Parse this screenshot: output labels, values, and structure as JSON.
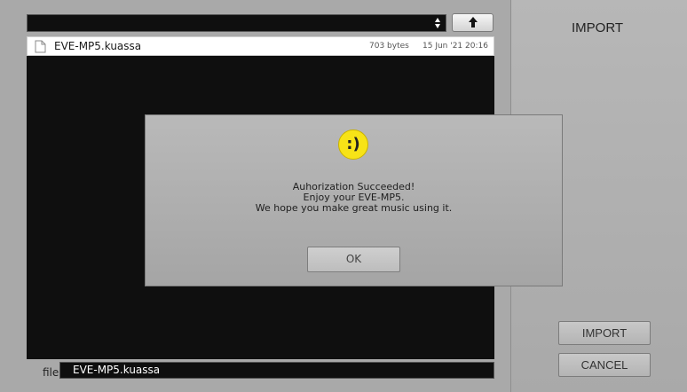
{
  "browser": {
    "path_select": {
      "value": ""
    },
    "up_button": {
      "icon": "arrow-up-icon"
    },
    "files": [
      {
        "name": "EVE-MP5.kuassa",
        "size": "703 bytes",
        "date": "15 Jun '21 20:16",
        "icon": "document-icon"
      }
    ],
    "file_label": "file:",
    "file_input_value": "EVE-MP5.kuassa"
  },
  "side_panel": {
    "title": "IMPORT",
    "import_label": "IMPORT",
    "cancel_label": "CANCEL"
  },
  "dialog": {
    "emoticon": ":)",
    "emoticon_color": "#f7e317",
    "message_lines": [
      "Auhorization Succeeded!",
      "Enjoy your EVE-MP5.",
      "We hope you make great music using it."
    ],
    "ok_label": "OK"
  }
}
